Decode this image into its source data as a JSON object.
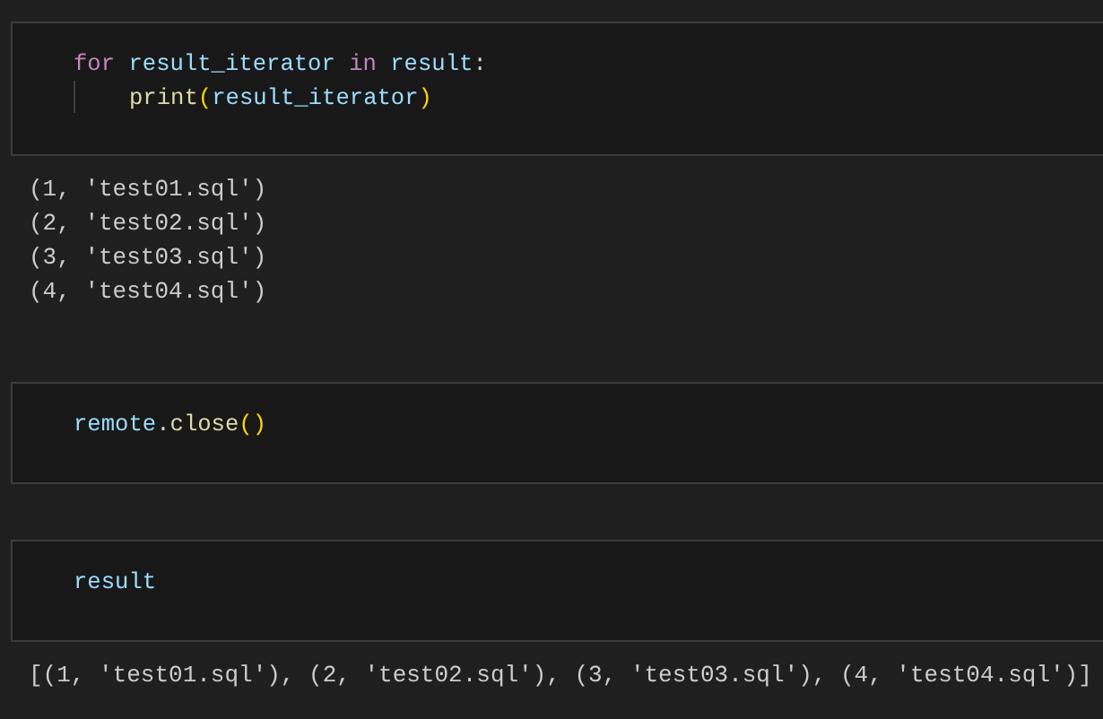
{
  "cells": [
    {
      "code_lines": [
        {
          "tokens": [
            {
              "text": "for",
              "kind": "keyword"
            },
            {
              "text": "result_iterator",
              "kind": "variable",
              "space_before": true
            },
            {
              "text": "in",
              "kind": "keyword",
              "space_before": true
            },
            {
              "text": "result",
              "kind": "variable",
              "space_before": true
            },
            {
              "text": ":",
              "kind": "plain"
            }
          ],
          "children": [
            {
              "tokens": [
                {
                  "text": "print",
                  "kind": "function"
                },
                {
                  "text": "(",
                  "kind": "paren"
                },
                {
                  "text": "result_iterator",
                  "kind": "variable"
                },
                {
                  "text": ")",
                  "kind": "paren"
                }
              ]
            }
          ]
        }
      ],
      "outputs": [
        "(1, 'test01.sql')",
        "(2, 'test02.sql')",
        "(3, 'test03.sql')",
        "(4, 'test04.sql')"
      ]
    },
    {
      "code_lines": [
        {
          "tokens": [
            {
              "text": "remote",
              "kind": "variable"
            },
            {
              "text": ".",
              "kind": "plain"
            },
            {
              "text": "close",
              "kind": "function"
            },
            {
              "text": "()",
              "kind": "paren"
            }
          ]
        }
      ]
    },
    {
      "code_lines": [
        {
          "tokens": [
            {
              "text": "result",
              "kind": "variable"
            }
          ]
        }
      ],
      "outputs": [
        "[(1, 'test01.sql'), (2, 'test02.sql'), (3, 'test03.sql'), (4, 'test04.sql')]"
      ]
    }
  ]
}
